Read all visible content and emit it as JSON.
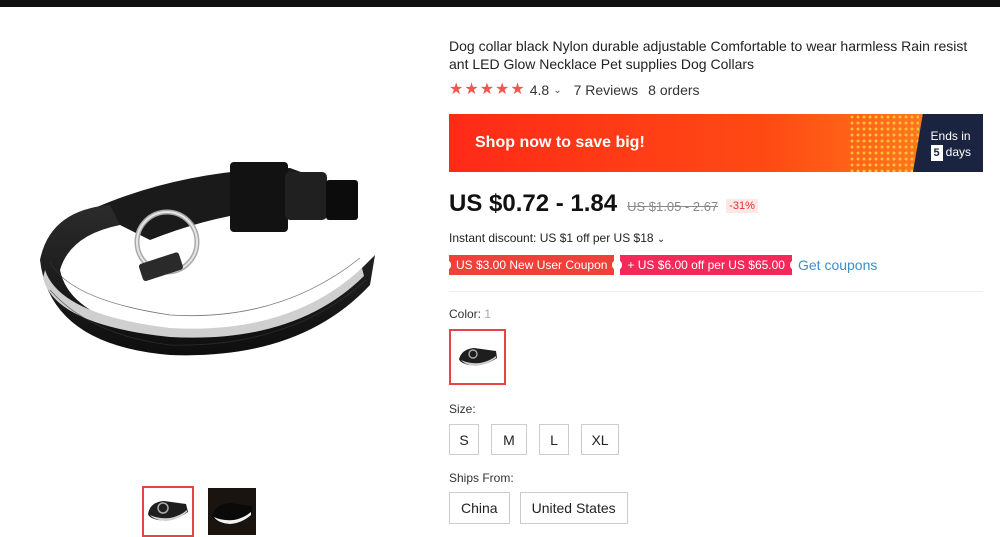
{
  "product": {
    "title": "Dog collar black Nylon durable adjustable Comfortable to wear harmless Rain resist ant LED Glow Necklace Pet supplies Dog Collars",
    "rating": {
      "stars": 5,
      "value": "4.8",
      "reviews": "7 Reviews",
      "orders": "8 orders"
    }
  },
  "banner": {
    "text": "Shop now to save big!",
    "ends_label": "Ends in",
    "days_num": "5",
    "days_word": "days"
  },
  "price": {
    "current": "US $0.72 - 1.84",
    "original": "US $1.05 - 2.67",
    "discount": "-31%"
  },
  "instant_discount": "Instant discount: US $1 off per US $18",
  "coupons": [
    {
      "label": "US $3.00 New User Coupon"
    },
    {
      "label": "+ US $6.00 off per US $65.00"
    }
  ],
  "get_coupons": "Get coupons",
  "color": {
    "label": "Color:",
    "count": "1"
  },
  "size": {
    "label": "Size:",
    "options": [
      "S",
      "M",
      "L",
      "XL"
    ]
  },
  "ships_from": {
    "label": "Ships From:",
    "options": [
      "China",
      "United States"
    ]
  },
  "colors": {
    "accent": "#e64545",
    "banner": "#ff3b1a",
    "link": "#3a8fc9",
    "star": "#f0584f"
  }
}
